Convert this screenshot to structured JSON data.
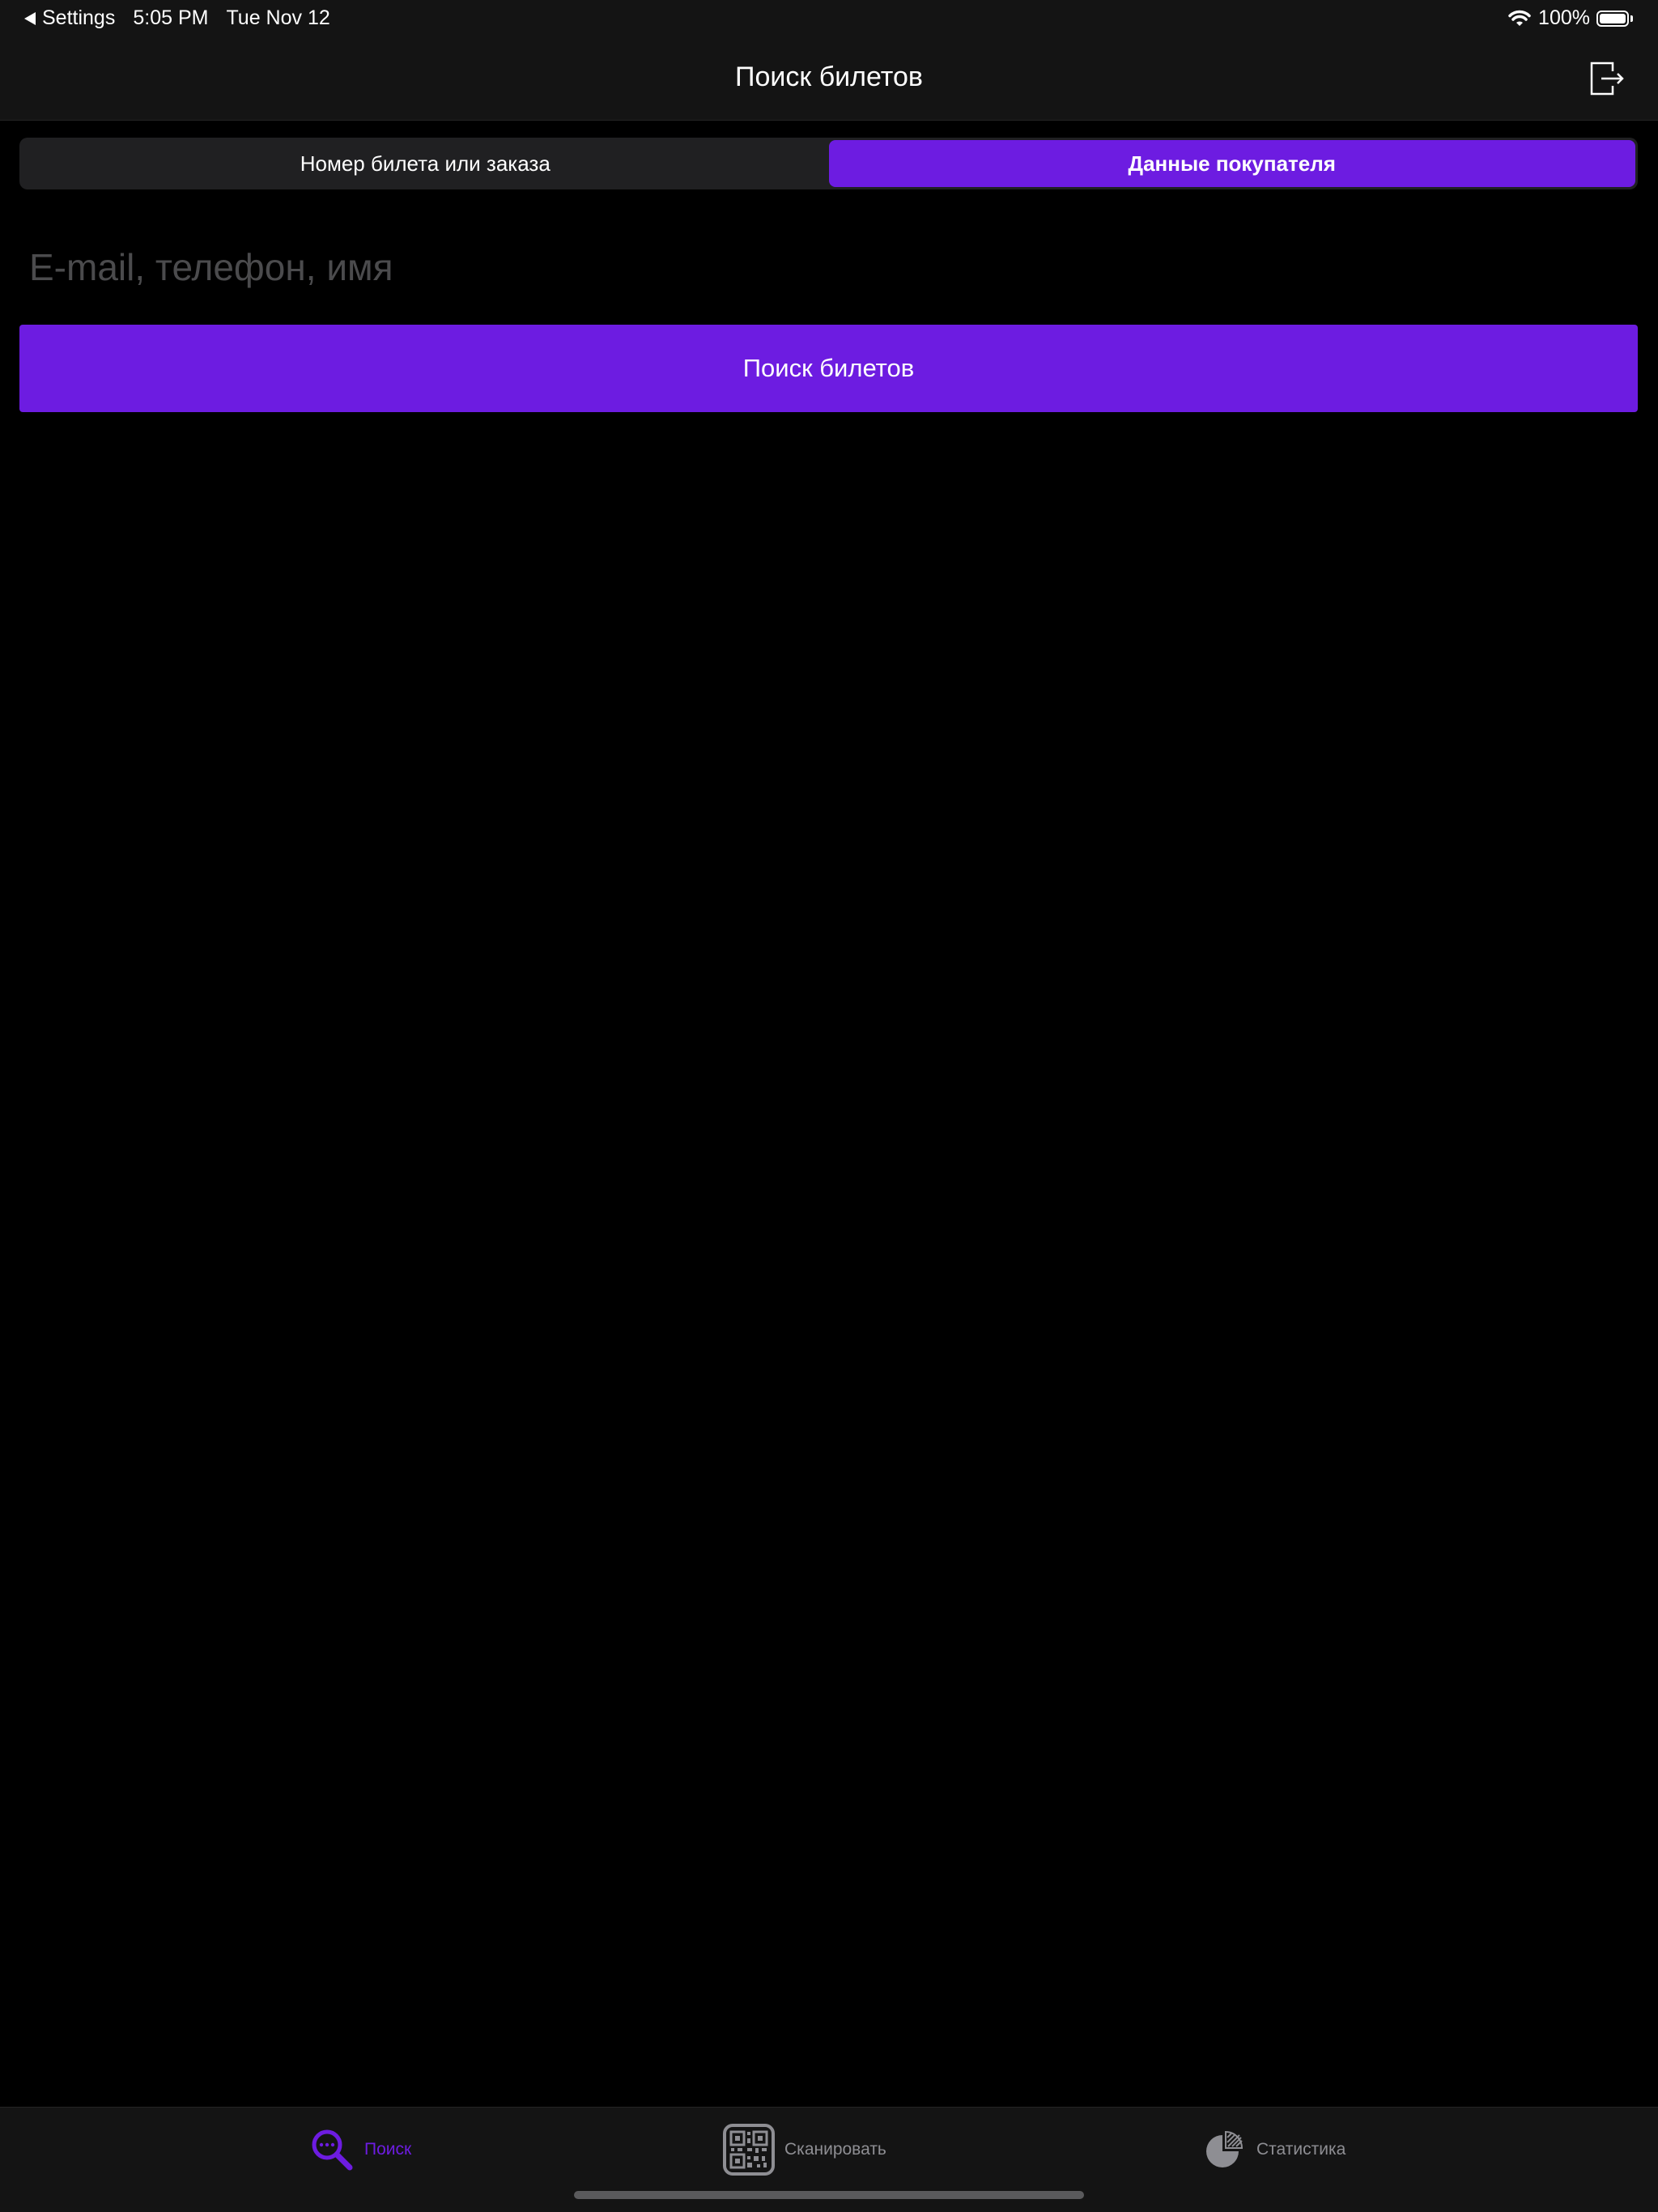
{
  "status_bar": {
    "back_label": "Settings",
    "time": "5:05 PM",
    "date": "Tue Nov 12",
    "battery": "100%",
    "battery_level": 1.0
  },
  "nav": {
    "title": "Поиск билетов",
    "logout_icon": "logout-icon"
  },
  "segments": [
    {
      "label": "Номер билета или заказа",
      "selected": false
    },
    {
      "label": "Данные покупателя",
      "selected": true
    }
  ],
  "search": {
    "placeholder": "E-mail, телефон, имя",
    "value": ""
  },
  "search_button": {
    "label": "Поиск билетов"
  },
  "tabs": [
    {
      "label": "Поиск",
      "icon": "search-icon",
      "active": true
    },
    {
      "label": "Сканировать",
      "icon": "qr-code-icon",
      "active": false
    },
    {
      "label": "Статистика",
      "icon": "pie-chart-icon",
      "active": false
    }
  ],
  "colors": {
    "accent": "#6d1ce1",
    "background": "#000000",
    "bar_background": "#141414",
    "inactive_tab": "#8e8e93",
    "placeholder": "#4b4b4d"
  }
}
